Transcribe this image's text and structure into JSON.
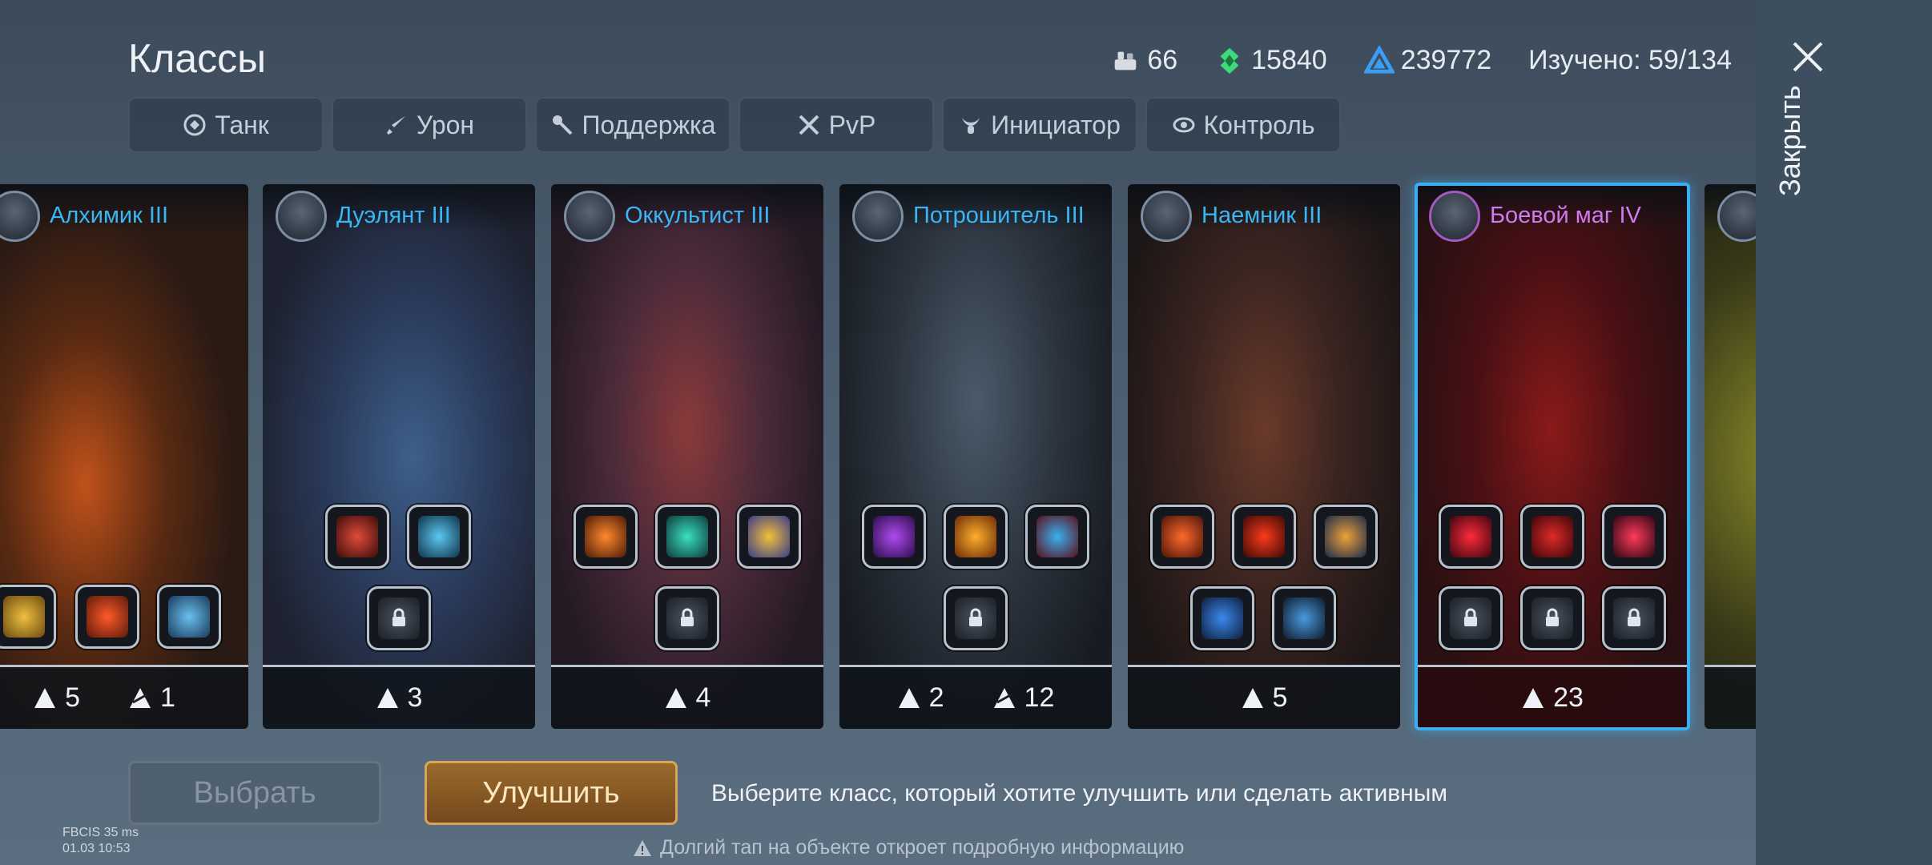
{
  "header": {
    "title": "Классы",
    "resources": [
      {
        "icon": "ingot-icon",
        "value": "66"
      },
      {
        "icon": "green-crystal-icon",
        "value": "15840"
      },
      {
        "icon": "blue-triangle-icon",
        "value": "239772"
      }
    ],
    "learned": "Изучено: 59/134"
  },
  "tabs": [
    {
      "label": "Танк",
      "icon": "shield-icon"
    },
    {
      "label": "Урон",
      "icon": "sword-icon"
    },
    {
      "label": "Поддержка",
      "icon": "staff-icon"
    },
    {
      "label": "PvP",
      "icon": "crossed-swords-icon"
    },
    {
      "label": "Инициатор",
      "icon": "horns-icon"
    },
    {
      "label": "Контроль",
      "icon": "eye-icon"
    }
  ],
  "cards": [
    {
      "name": "Алхимик III",
      "stat1": "5",
      "stat2": "1",
      "accent": "#e08a2a"
    },
    {
      "name": "Дуэлянт III",
      "stat1": "3",
      "stat2": "",
      "accent": "#4a77b8"
    },
    {
      "name": "Оккультист III",
      "stat1": "4",
      "stat2": "",
      "accent": "#b8463a"
    },
    {
      "name": "Потрошитель III",
      "stat1": "2",
      "stat2": "12",
      "accent": "#3aa0d8"
    },
    {
      "name": "Наемник III",
      "stat1": "5",
      "stat2": "",
      "accent": "#b83a2a"
    },
    {
      "name": "Боевой маг IV",
      "stat1": "23",
      "stat2": "",
      "accent": "#d82a2a"
    }
  ],
  "buttons": {
    "select": "Выбрать",
    "upgrade": "Улучшить"
  },
  "hint": "Выберите класс, который хотите улучшить или сделать активным",
  "footnote": "Долгий тап на объекте откроет подробную информацию",
  "debug": {
    "line1": "FBCIS 35 ms",
    "line2": "01.03 10:53"
  },
  "side": {
    "close": "Закрыть"
  },
  "colors": {
    "selected": "#3aaef0",
    "name_blue": "#38b6f5",
    "name_purple": "#d07af0",
    "upgrade": "#d9a35a"
  }
}
